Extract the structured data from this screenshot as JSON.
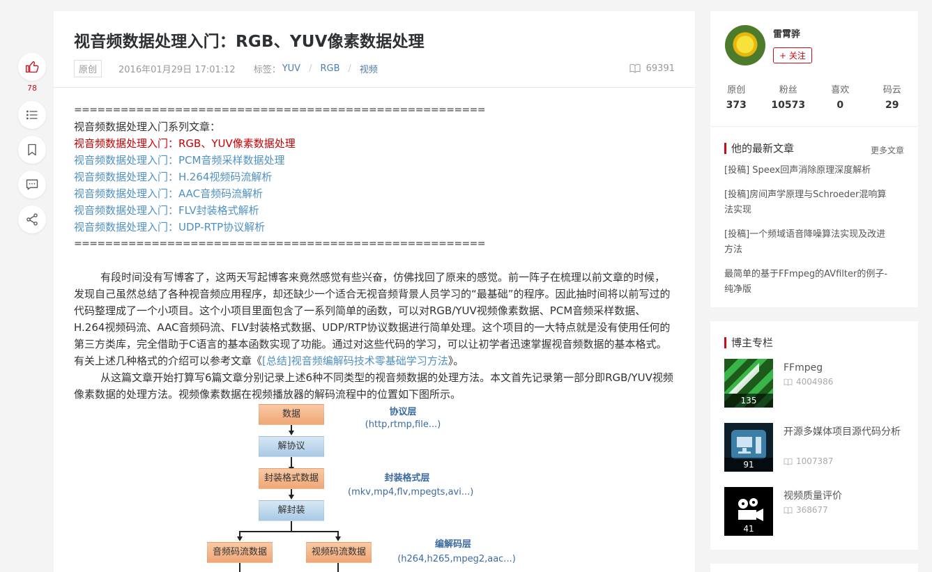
{
  "tools": {
    "like_count": "78"
  },
  "article": {
    "title": "视音频数据处理入门：RGB、YUV像素数据处理",
    "badge": "原创",
    "date": "2016年01月29日 17:01:12",
    "tags_label": "标签：",
    "tags": [
      "YUV",
      "RGB",
      "视频"
    ],
    "views": "69391",
    "separator_line": "=====================================================",
    "series_heading": "视音频数据处理入门系列文章：",
    "series_links": [
      "视音频数据处理入门：RGB、YUV像素数据处理",
      "视音频数据处理入门：PCM音频采样数据处理",
      "视音频数据处理入门：H.264视频码流解析",
      "视音频数据处理入门：AAC音频码流解析",
      "视音频数据处理入门：FLV封装格式解析",
      "视音频数据处理入门：UDP-RTP协议解析"
    ],
    "para1_before": "有段时间没有写博客了，这两天写起博客来竟然感觉有些兴奋，仿佛找回了原来的感觉。前一阵子在梳理以前文章的时候，发现自己虽然总结了各种视音频应用程序，却还缺少一个适合无视音频背景人员学习的“最基础”的程序。因此抽时间将以前写过的代码整理成了一个小项目。这个小项目里面包含了一系列简单的函数，可以对RGB/YUV视频像素数据、PCM音频采样数据、H.264视频码流、AAC音频码流、FLV封装格式数据、UDP/RTP协议数据进行简单处理。这个项目的一大特点就是没有使用任何的第三方类库，完全借助于C语言的基本函数实现了功能。通过对这些代码的学习，可以让初学者迅速掌握视音频数据的基本格式。有关上述几种格式的介绍可以参考文章《",
    "para1_link": "[总结]视音频编解码技术零基础学习方法",
    "para1_after": "》。",
    "para2": "从这篇文章开始打算写6篇文章分别记录上述6种不同类型的视音频数据的处理方法。本文首先记录第一部分即RGB/YUV视频像素数据的处理方法。视频像素数据在视频播放器的解码流程中的位置如下图所示。",
    "diagram": {
      "box_data": "数据",
      "box_deprotocol": "解协议",
      "box_container_data": "封装格式数据",
      "box_demux": "解封装",
      "box_audio_stream": "音频码流数据",
      "box_video_stream": "视频码流数据",
      "layer_protocol": "协议层",
      "layer_protocol_sub": "(http,rtmp,file...)",
      "layer_container": "封装格式层",
      "layer_container_sub": "(mkv,mp4,flv,mpegts,avi...)",
      "layer_codec": "编解码层",
      "layer_codec_sub": "(h264,h265,mpeg2,aac...)"
    }
  },
  "sidebar": {
    "author": {
      "name": "雷霄骅",
      "follow_label": "+ 关注"
    },
    "stats": [
      {
        "label": "原创",
        "value": "373"
      },
      {
        "label": "粉丝",
        "value": "10573"
      },
      {
        "label": "喜欢",
        "value": "0"
      },
      {
        "label": "码云",
        "value": "29"
      }
    ],
    "latest": {
      "title": "他的最新文章",
      "more": "更多文章",
      "items": [
        "[投稿] Speex回声消除原理深度解析",
        "[投稿]房间声学原理与Schroeder混响算法实现",
        "[投稿]一个频域语音降噪算法实现及改进方法",
        "最简单的基于FFmpeg的AVfilter的例子-纯净版"
      ]
    },
    "columns": {
      "title": "博主专栏",
      "items": [
        {
          "name": "FFmpeg",
          "views": "4004986",
          "count": "135"
        },
        {
          "name": "开源多媒体项目源代码分析",
          "views": "1007387",
          "count": "91"
        },
        {
          "name": "视频质量评价",
          "views": "368677",
          "count": "41"
        }
      ]
    }
  }
}
